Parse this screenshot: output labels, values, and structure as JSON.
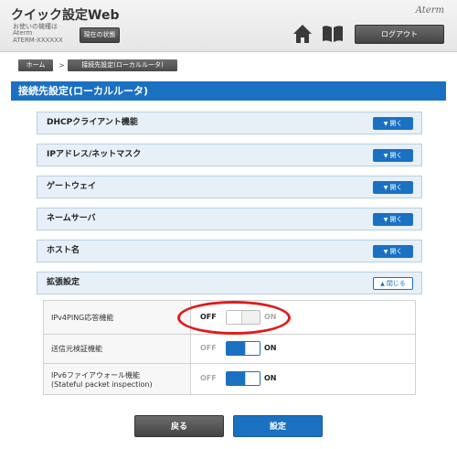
{
  "header": {
    "app_title": "クイック設定Web",
    "model_label": "お使いの機種は",
    "model_line1": "Aterm",
    "model_line2": "ATERM-XXXXXX",
    "status_button": "現在の状態",
    "logo": "Aterm",
    "logout_button": "ログアウト"
  },
  "breadcrumb": {
    "home": "ホーム",
    "separator": ">",
    "current": "接続先設定(ローカルルータ)"
  },
  "page_title": "接続先設定(ローカルルータ)",
  "sections": [
    {
      "label": "DHCPクライアント機能",
      "button": "開く"
    },
    {
      "label": "IPアドレス/ネットマスク",
      "button": "開く"
    },
    {
      "label": "ゲートウェイ",
      "button": "開く"
    },
    {
      "label": "ネームサーバ",
      "button": "開く"
    },
    {
      "label": "ホスト名",
      "button": "開く"
    },
    {
      "label": "拡張設定",
      "button": "閉じる"
    }
  ],
  "settings": [
    {
      "label": "IPv4PING応答機能",
      "off": "OFF",
      "on": "ON",
      "state": "OFF"
    },
    {
      "label": "送信元検証機能",
      "off": "OFF",
      "on": "ON",
      "state": "ON"
    },
    {
      "label1": "IPv6ファイアウォール機能",
      "label2": "(Stateful packet inspection)",
      "off": "OFF",
      "on": "ON",
      "state": "ON"
    }
  ],
  "footer": {
    "back_button": "戻る",
    "apply_button": "設定"
  },
  "colors": {
    "accent": "#1b71c1",
    "highlight": "#e01b1b",
    "dark_button": "#555555"
  }
}
